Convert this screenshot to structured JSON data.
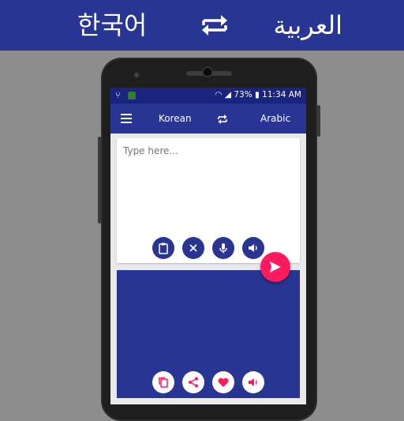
{
  "banner": {
    "source_lang": "한국어",
    "target_lang": "العربية",
    "swap_icon": "swap-icon"
  },
  "statusbar": {
    "left_icons": [
      "usb-icon",
      "app-notification-icon"
    ],
    "battery": "73%",
    "time": "11:34 AM"
  },
  "toolbar": {
    "source_lang": "Korean",
    "target_lang": "Arabic"
  },
  "input": {
    "placeholder": "Type here...",
    "buttons": [
      "clipboard-icon",
      "close-icon",
      "microphone-icon",
      "volume-icon"
    ]
  },
  "output": {
    "buttons": [
      "copy-icon",
      "share-icon",
      "heart-icon",
      "volume-icon"
    ]
  },
  "colors": {
    "primary": "#283593",
    "primary_dark": "#1a237e",
    "accent": "#ff1a5e"
  }
}
